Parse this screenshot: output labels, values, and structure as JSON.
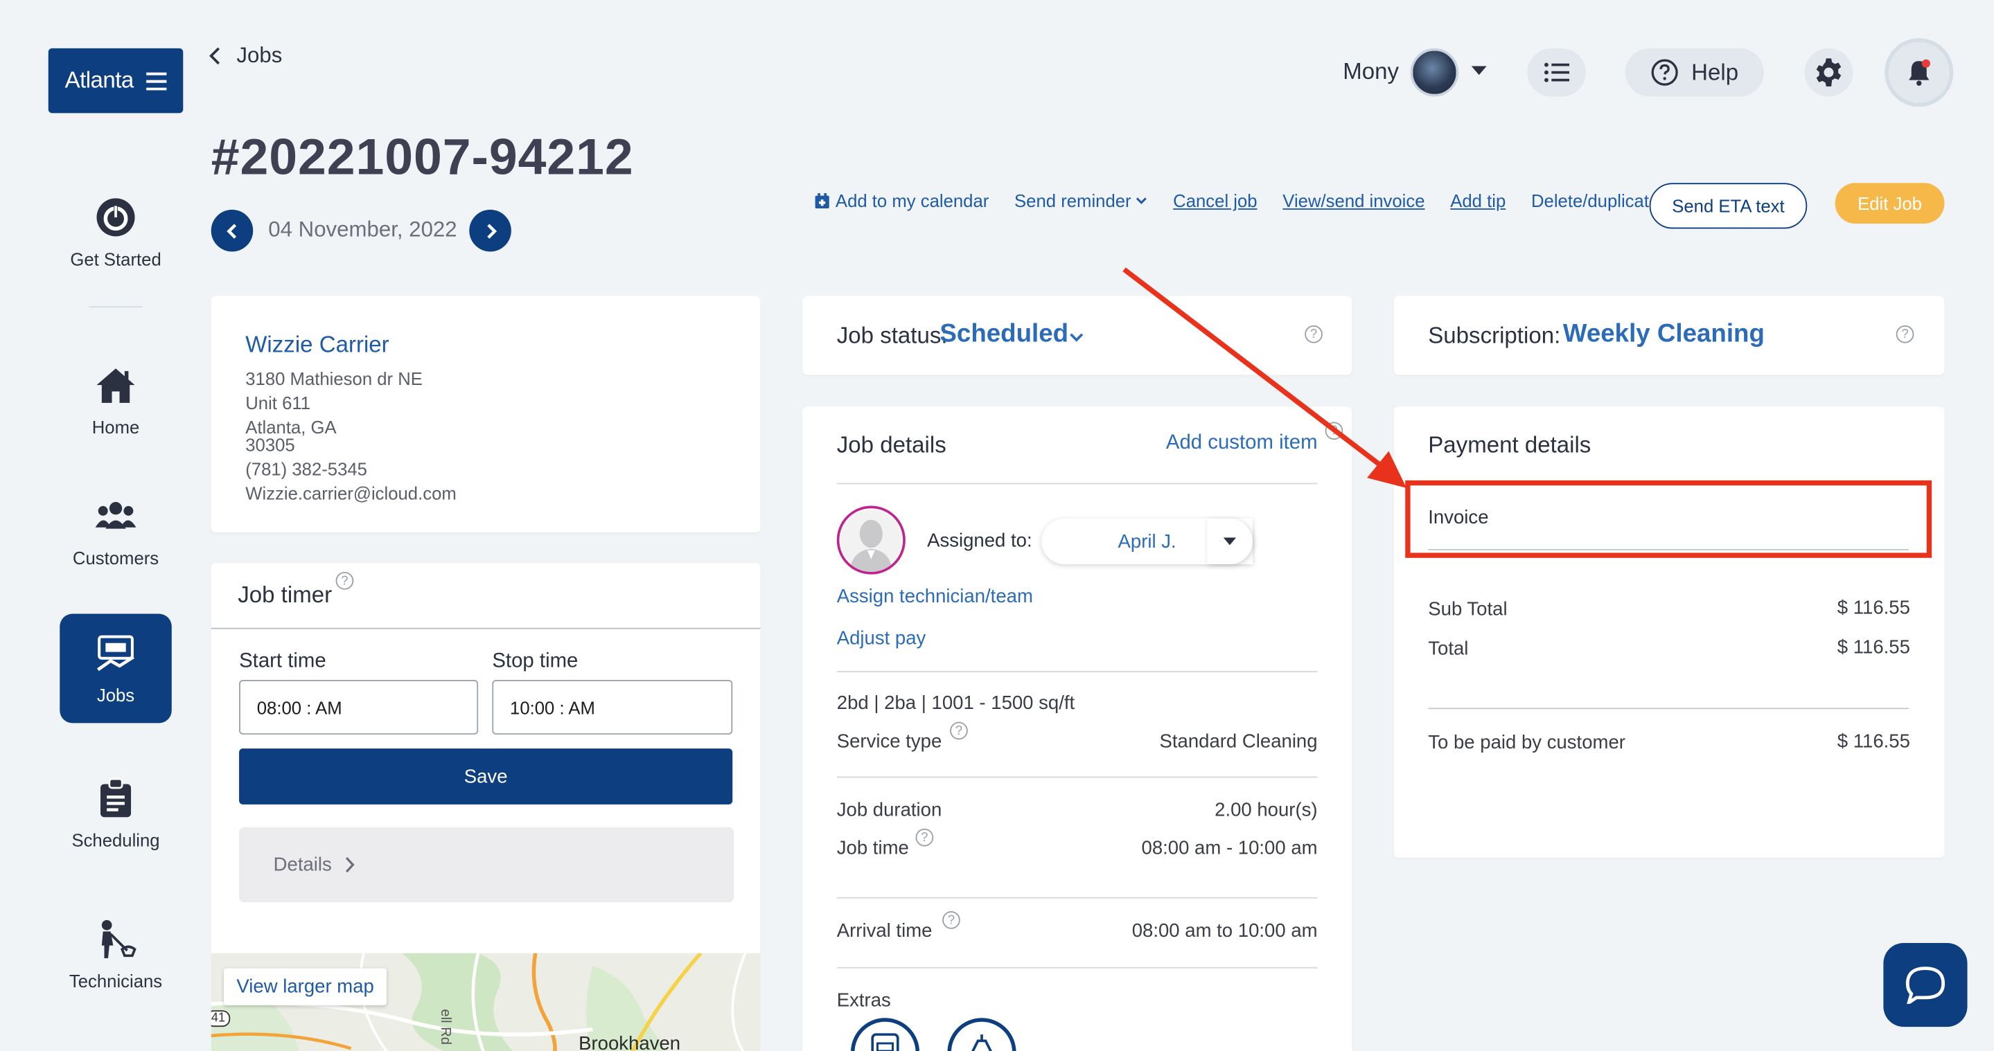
{
  "sidebar": {
    "brand": "Atlanta",
    "items": [
      {
        "label": "Get Started",
        "icon": "power-icon"
      },
      {
        "label": "Home",
        "icon": "home-icon"
      },
      {
        "label": "Customers",
        "icon": "users-icon"
      },
      {
        "label": "Jobs",
        "icon": "jobs-icon",
        "active": true
      },
      {
        "label": "Scheduling",
        "icon": "clipboard-icon"
      },
      {
        "label": "Technicians",
        "icon": "technician-icon"
      }
    ]
  },
  "header": {
    "back_label": "Jobs",
    "job_number": "#20221007-94212",
    "date": "04 November, 2022",
    "user_name": "Mony",
    "help_label": "Help"
  },
  "toolbar": {
    "add_calendar": "Add to my calendar",
    "send_reminder": "Send reminder",
    "cancel_job": "Cancel job",
    "view_invoice": "View/send invoice",
    "add_tip": "Add tip",
    "delete_duplicate": "Delete/duplicate",
    "send_eta": "Send ETA text",
    "edit_job": "Edit Job"
  },
  "customer": {
    "name": "Wizzie Carrier",
    "address1": "3180 Mathieson dr NE",
    "address2": "Unit 611",
    "city_state": "Atlanta, GA",
    "zip": "30305",
    "phone": "(781) 382-5345",
    "email": "Wizzie.carrier@icloud.com"
  },
  "timer": {
    "title": "Job timer",
    "start_label": "Start time",
    "stop_label": "Stop time",
    "start_value": "08:00 : AM",
    "stop_value": "10:00 : AM",
    "save_label": "Save",
    "details_label": "Details"
  },
  "map": {
    "view_larger": "View larger map",
    "place": "Brookhaven",
    "road": "ell Rd",
    "route": "41"
  },
  "job_status": {
    "label": "Job status:",
    "value": "Scheduled"
  },
  "job_details": {
    "title": "Job details",
    "add_custom": "Add custom item",
    "assigned_label": "Assigned to:",
    "assigned_value": "April J.",
    "assign_link": "Assign technician/team",
    "adjust_pay": "Adjust pay",
    "size": "2bd | 2ba | 1001 - 1500 sq/ft",
    "service_type_label": "Service type",
    "service_type_value": "Standard Cleaning",
    "duration_label": "Job duration",
    "duration_value": "2.00 hour(s)",
    "job_time_label": "Job time",
    "job_time_value": "08:00 am - 10:00 am",
    "arrival_label": "Arrival time",
    "arrival_value": "08:00 am to 10:00 am",
    "extras_label": "Extras"
  },
  "subscription": {
    "label": "Subscription:",
    "value": "Weekly Cleaning"
  },
  "payment": {
    "title": "Payment details",
    "invoice_label": "Invoice",
    "subtotal_label": "Sub Total",
    "subtotal_value": "$ 116.55",
    "total_label": "Total",
    "total_value": "$ 116.55",
    "customer_pays_label": "To be paid by customer",
    "customer_pays_value": "$ 116.55"
  },
  "colors": {
    "primary": "#0d3e80",
    "link": "#1f5aa6",
    "accent": "#f7b84a",
    "annotation": "#e8321c"
  }
}
